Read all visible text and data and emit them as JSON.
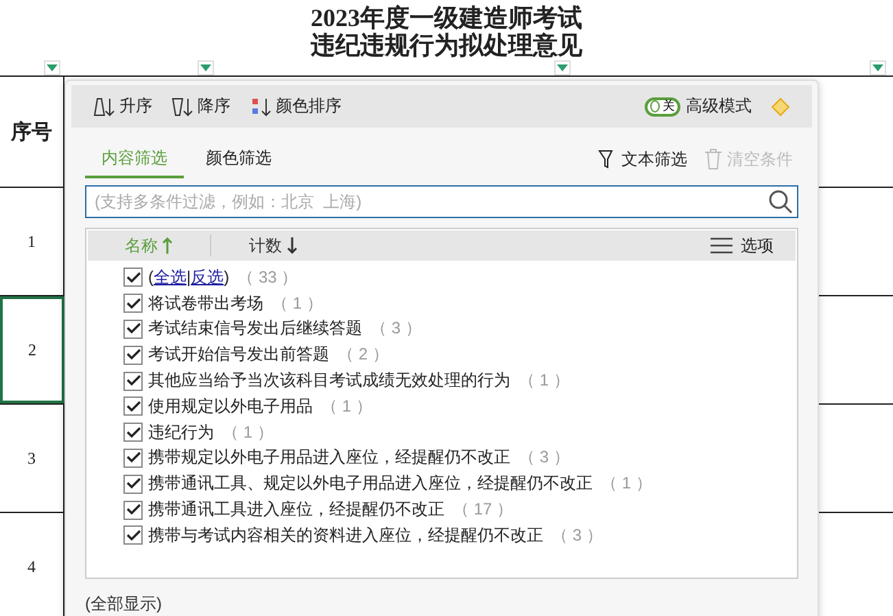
{
  "sheet": {
    "title_lines": [
      "2023年度一级建造师考试",
      "违纪违规行为拟处理意见"
    ],
    "header": "序号",
    "rows": [
      {
        "label": "1",
        "selected": false
      },
      {
        "label": "2",
        "selected": true
      },
      {
        "label": "3",
        "selected": false
      },
      {
        "label": "4",
        "selected": false
      }
    ]
  },
  "popup": {
    "sort_buttons": [
      {
        "kind": "asc",
        "label": "升序"
      },
      {
        "kind": "desc",
        "label": "降序"
      },
      {
        "kind": "color",
        "label": "颜色排序"
      }
    ],
    "advanced_mode": {
      "switch_text": "关",
      "on": false,
      "label": "高级模式"
    },
    "tabs": [
      {
        "label": "内容筛选",
        "selected": true
      },
      {
        "label": "颜色筛选",
        "selected": false
      }
    ],
    "text_filter": {
      "label": "文本筛选",
      "disabled": false
    },
    "clear": {
      "label": "清空条件",
      "disabled": true
    },
    "search": {
      "placeholder": "(支持多条件过滤，例如：北京  上海)"
    },
    "columns": [
      {
        "label": "名称",
        "ascending": true,
        "selected": true
      },
      {
        "label": "计数",
        "ascending": false,
        "selected": false
      }
    ],
    "options": "选项",
    "select_all": {
      "open": "(",
      "all": "全选",
      "sep": "|",
      "invert": "反选",
      "close": ")",
      "count": "（ 33 ）",
      "checked": true
    },
    "items": [
      {
        "label": "将试卷带出考场",
        "count": "（ 1 ）",
        "checked": true
      },
      {
        "label": "考试结束信号发出后继续答题",
        "count": "（ 3 ）",
        "checked": true
      },
      {
        "label": "考试开始信号发出前答题",
        "count": "（ 2 ）",
        "checked": true
      },
      {
        "label": "其他应当给予当次该科目考试成绩无效处理的行为",
        "count": "（ 1 ）",
        "checked": true
      },
      {
        "label": "使用规定以外电子用品",
        "count": "（ 1 ）",
        "checked": true
      },
      {
        "label": "违纪行为",
        "count": "（ 1 ）",
        "checked": true
      },
      {
        "label": "携带规定以外电子用品进入座位，经提醒仍不改正",
        "count": "（ 3 ）",
        "checked": true
      },
      {
        "label": "携带通讯工具、规定以外电子用品进入座位，经提醒仍不改正",
        "count": "（ 1 ）",
        "checked": true
      },
      {
        "label": "携带通讯工具进入座位，经提醒仍不改正",
        "count": "（ 17 ）",
        "checked": true
      },
      {
        "label": "携带与考试内容相关的资料进入座位，经提醒仍不改正",
        "count": "（ 3 ）",
        "checked": true
      }
    ],
    "footer": "(全部显示)"
  }
}
